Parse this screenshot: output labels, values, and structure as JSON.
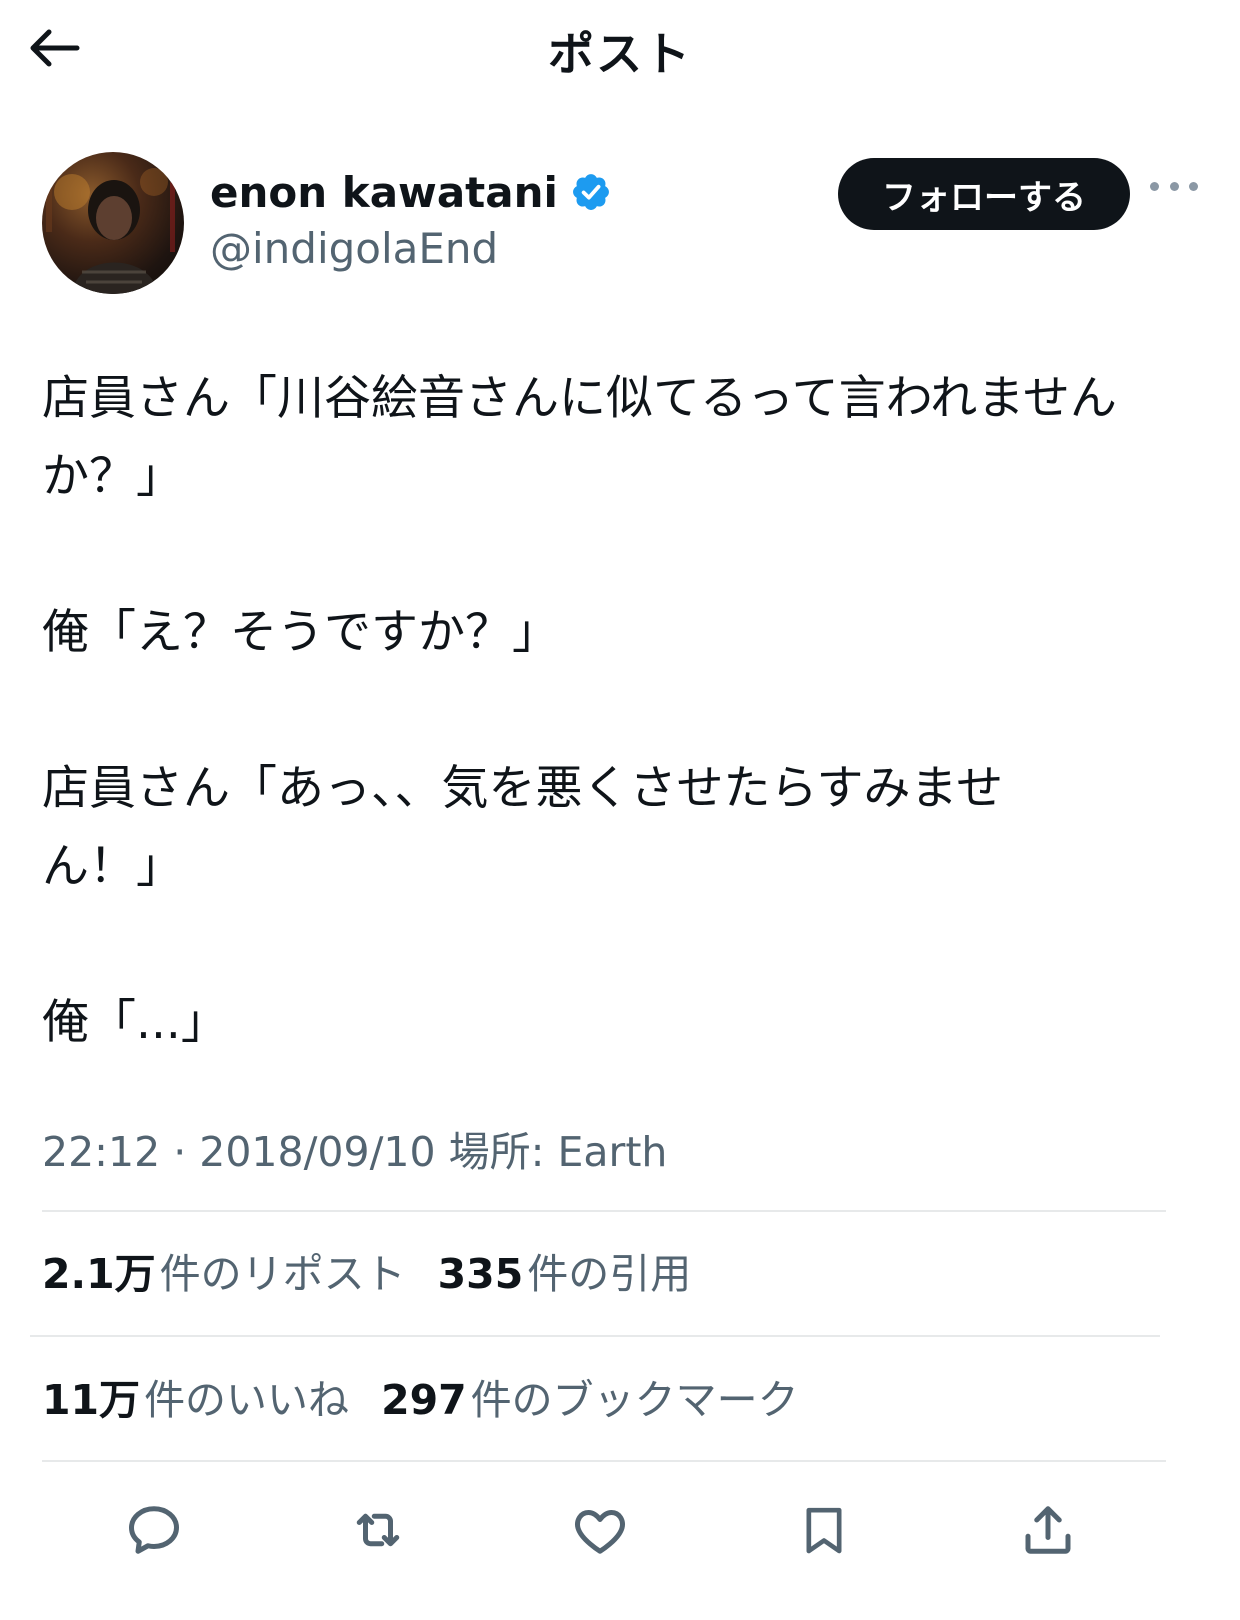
{
  "header": {
    "title": "ポスト",
    "back_icon": "arrow-left-icon"
  },
  "author": {
    "display_name": "enon kawatani",
    "handle": "@indigolaEnd",
    "verified": true,
    "verified_color": "#1d9bf0",
    "follow_label": "フォローする"
  },
  "post": {
    "lines": [
      "店員さん「川谷絵音さんに似てるって言われません",
      "か？」",
      "",
      "俺「え？そうですか？」",
      "",
      "店員さん「あっ、、気を悪くさせたらすみませ",
      "ん！」",
      "",
      "俺「...」"
    ]
  },
  "meta": {
    "text": "22:12 · 2018/09/10 場所: Earth"
  },
  "stats": {
    "reposts_count": "2.1万",
    "reposts_label": "件のリポスト",
    "quotes_count": "335",
    "quotes_label": "件の引用",
    "likes_count": "11万",
    "likes_label": "件のいいね",
    "bookmarks_count": "297",
    "bookmarks_label": "件のブックマーク"
  },
  "actions": [
    "reply-icon",
    "repost-icon",
    "like-icon",
    "bookmark-icon",
    "share-icon"
  ],
  "colors": {
    "text": "#0f1419",
    "secondary": "#536471",
    "divider": "#e7e9ea",
    "accent": "#1d9bf0"
  }
}
